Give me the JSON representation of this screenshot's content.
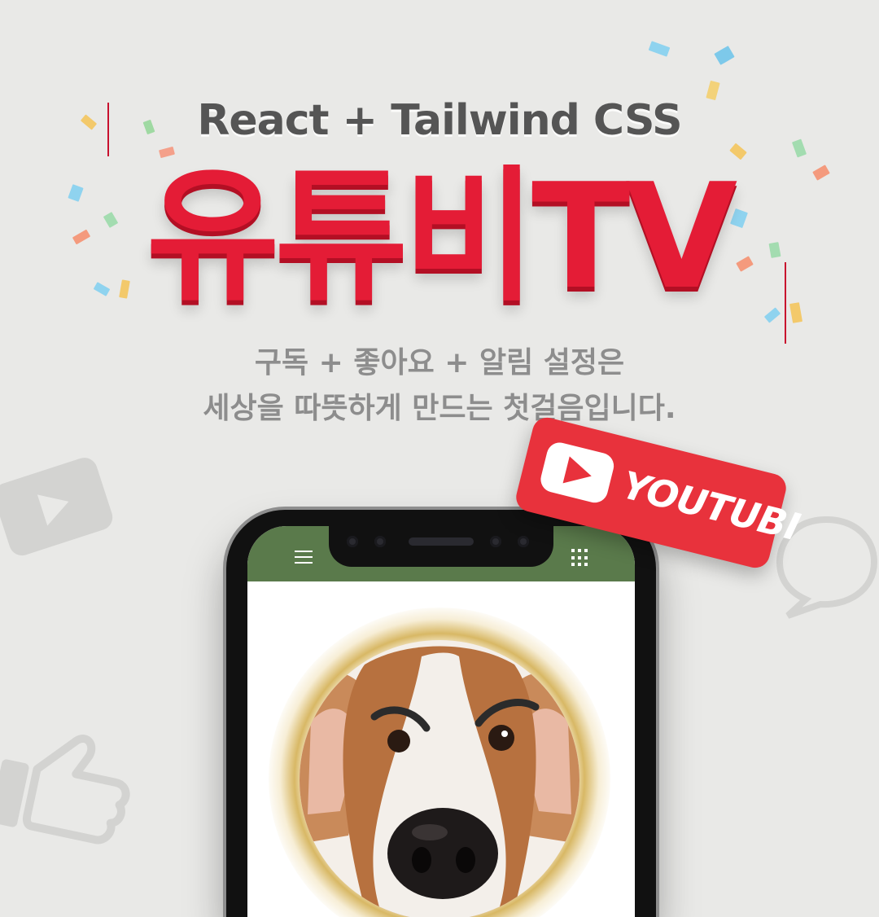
{
  "header": {
    "subtitle": "React + Tailwind CSS",
    "title": "유튜비TV",
    "desc_line1": "구독 + 좋아요 + 알림 설정은",
    "desc_line2": "세상을 따뜻하게 만드는 첫걸음입니다."
  },
  "badge": {
    "label": "YOUTUBI",
    "icon": "youtube-play-icon"
  },
  "phone": {
    "header_left_icon": "hamburger-menu-icon",
    "header_right_icon": "grid-apps-icon"
  },
  "colors": {
    "background": "#e9e9e7",
    "title_red": "#e41c36",
    "badge_red": "#e8323c",
    "app_header_green": "#5a7a4b",
    "text_gray": "#8d8d8d"
  }
}
